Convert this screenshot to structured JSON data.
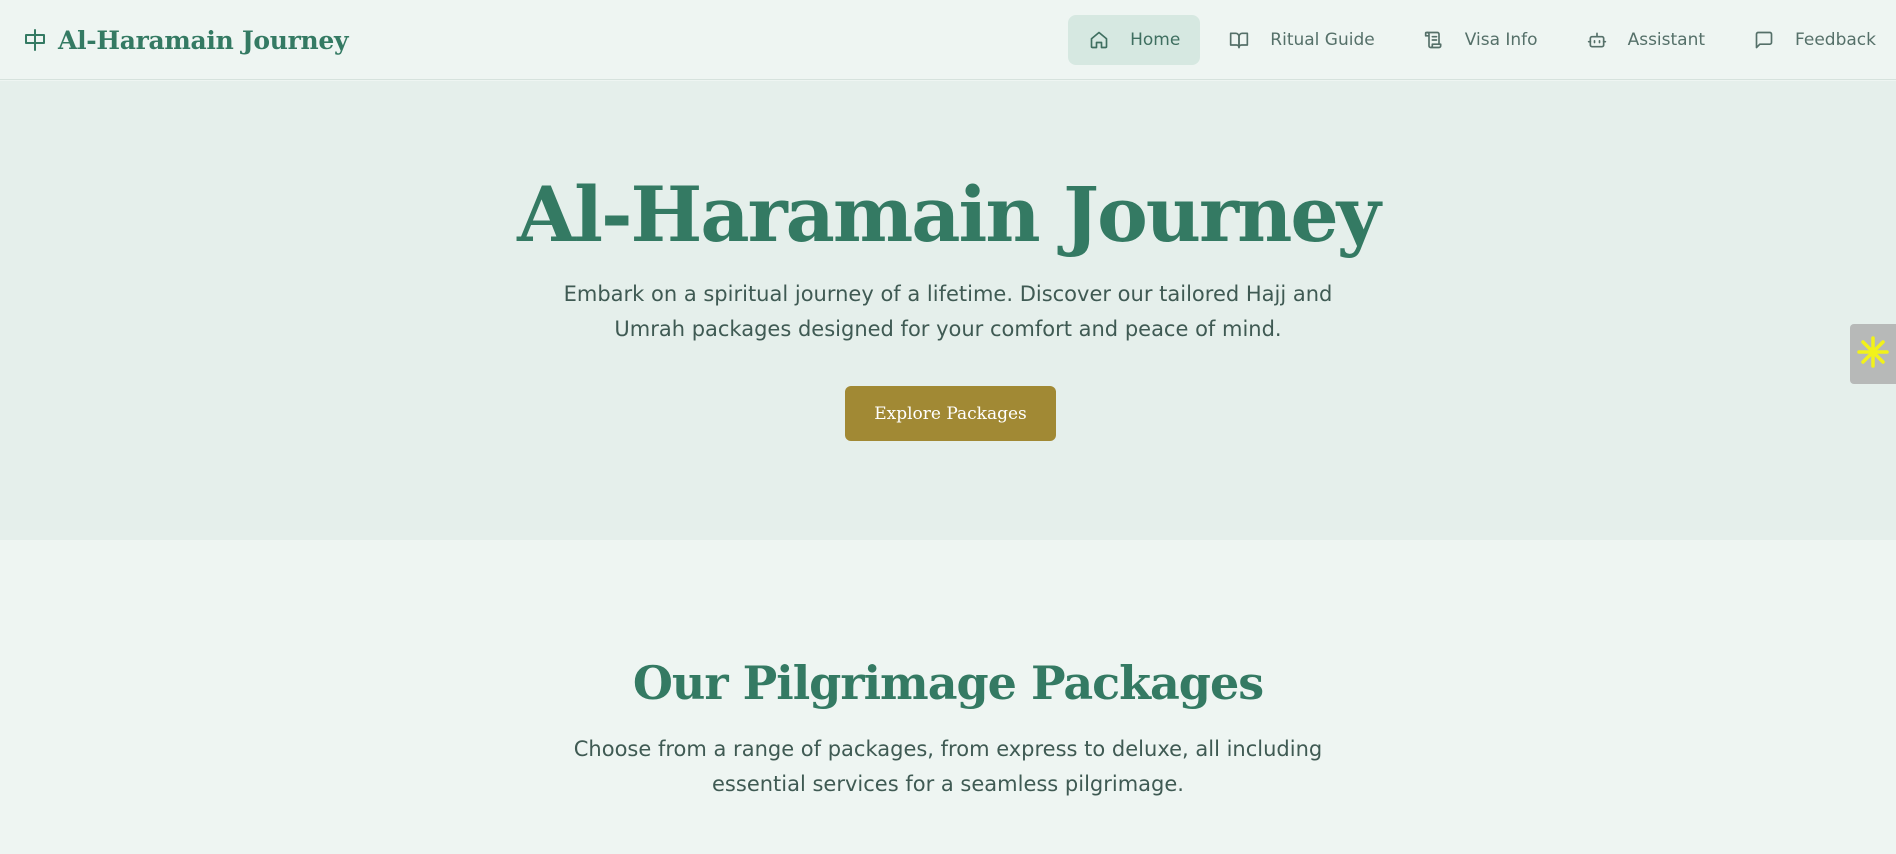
{
  "header": {
    "brand_name": "Al-Haramain Journey",
    "brand_icon": "kaaba-icon",
    "nav": [
      {
        "label": "Home",
        "icon": "home-icon",
        "active": true
      },
      {
        "label": "Ritual Guide",
        "icon": "book-icon",
        "active": false
      },
      {
        "label": "Visa Info",
        "icon": "scroll-icon",
        "active": false
      },
      {
        "label": "Assistant",
        "icon": "robot-icon",
        "active": false
      },
      {
        "label": "Feedback",
        "icon": "message-icon",
        "active": false
      }
    ]
  },
  "hero": {
    "title": "Al-Haramain Journey",
    "subtitle": "Embark on a spiritual journey of a lifetime. Discover our tailored Hajj and Umrah packages designed for your comfort and peace of mind.",
    "cta_label": "Explore Packages"
  },
  "packages": {
    "title": "Our Pilgrimage Packages",
    "subtitle": "Choose from a range of packages, from express to deluxe, all including essential services for a seamless pilgrimage."
  },
  "side_widget": {
    "icon": "sparkle-icon"
  },
  "colors": {
    "brand_green": "#347a63",
    "gold_button": "#a18934",
    "page_bg": "#eef5f2",
    "hero_bg": "#e5efeb",
    "active_nav_bg": "#d6e8e1",
    "widget_accent": "#f2f21a"
  }
}
